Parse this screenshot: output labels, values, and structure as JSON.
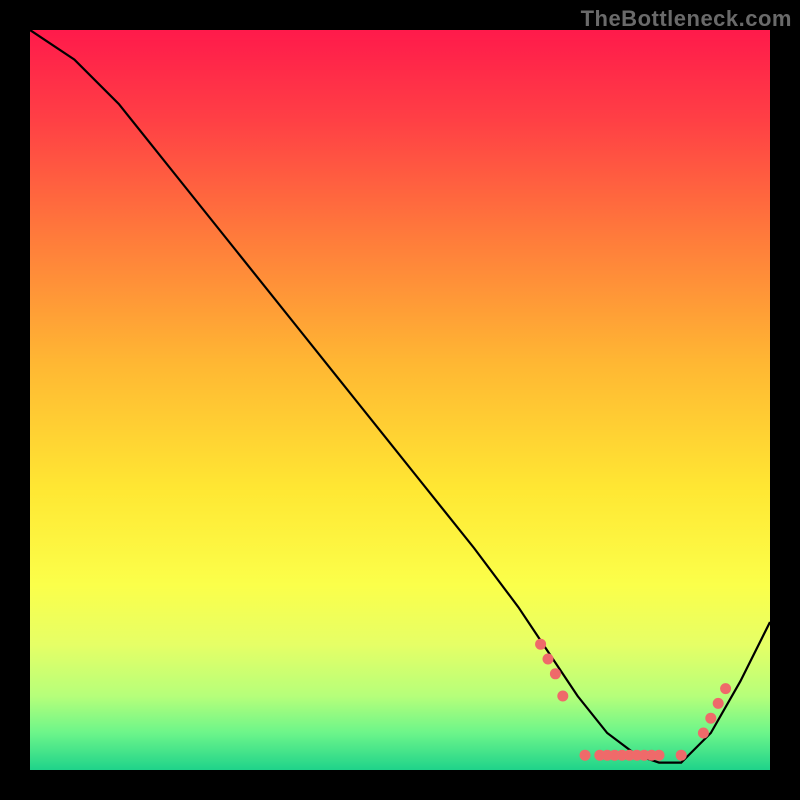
{
  "watermark": "TheBottleneck.com",
  "chart_data": {
    "type": "line",
    "title": "",
    "xlabel": "",
    "ylabel": "",
    "xlim": [
      0,
      100
    ],
    "ylim": [
      0,
      100
    ],
    "grid": false,
    "background_gradient": {
      "stops": [
        {
          "pct": 0,
          "color": "#ff1a4b"
        },
        {
          "pct": 12,
          "color": "#ff3f45"
        },
        {
          "pct": 28,
          "color": "#ff7b3b"
        },
        {
          "pct": 45,
          "color": "#ffb733"
        },
        {
          "pct": 62,
          "color": "#ffe733"
        },
        {
          "pct": 75,
          "color": "#fbff4a"
        },
        {
          "pct": 83,
          "color": "#e6ff66"
        },
        {
          "pct": 90,
          "color": "#b6ff7a"
        },
        {
          "pct": 95,
          "color": "#6cf58a"
        },
        {
          "pct": 100,
          "color": "#1fd38a"
        }
      ]
    },
    "series": [
      {
        "name": "bottleneck-curve",
        "color": "#000000",
        "x": [
          0,
          6,
          12,
          20,
          28,
          36,
          44,
          52,
          60,
          66,
          70,
          74,
          78,
          82,
          85,
          88,
          92,
          96,
          100
        ],
        "y": [
          100,
          96,
          90,
          80,
          70,
          60,
          50,
          40,
          30,
          22,
          16,
          10,
          5,
          2,
          1,
          1,
          5,
          12,
          20
        ]
      }
    ],
    "markers": {
      "name": "highlighted-points",
      "color": "#ef6a6a",
      "points": [
        {
          "x": 69,
          "y": 17
        },
        {
          "x": 70,
          "y": 15
        },
        {
          "x": 71,
          "y": 13
        },
        {
          "x": 72,
          "y": 10
        },
        {
          "x": 75,
          "y": 2
        },
        {
          "x": 77,
          "y": 2
        },
        {
          "x": 78,
          "y": 2
        },
        {
          "x": 79,
          "y": 2
        },
        {
          "x": 80,
          "y": 2
        },
        {
          "x": 81,
          "y": 2
        },
        {
          "x": 82,
          "y": 2
        },
        {
          "x": 83,
          "y": 2
        },
        {
          "x": 84,
          "y": 2
        },
        {
          "x": 85,
          "y": 2
        },
        {
          "x": 88,
          "y": 2
        },
        {
          "x": 91,
          "y": 5
        },
        {
          "x": 92,
          "y": 7
        },
        {
          "x": 93,
          "y": 9
        },
        {
          "x": 94,
          "y": 11
        }
      ]
    }
  }
}
